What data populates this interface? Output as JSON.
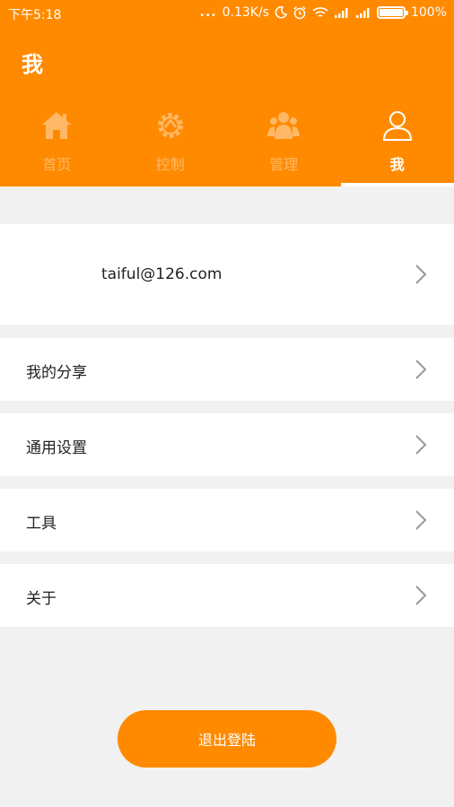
{
  "status_bar": {
    "time": "下午5:18",
    "dots": "...",
    "network_speed": "0.13K/s",
    "battery_text": "100%",
    "icons": [
      "moon-icon",
      "alarm-icon",
      "wifi-icon",
      "signal-icon",
      "signal-icon",
      "battery-icon"
    ]
  },
  "header": {
    "title": "我"
  },
  "tabs": [
    {
      "label": "首页",
      "icon": "home-icon",
      "active": false
    },
    {
      "label": "控制",
      "icon": "gear-icon",
      "active": false
    },
    {
      "label": "管理",
      "icon": "users-icon",
      "active": false
    },
    {
      "label": "我",
      "icon": "user-icon",
      "active": true
    }
  ],
  "account": {
    "email": "taiful@126.com"
  },
  "menu": [
    {
      "label": "我的分享"
    },
    {
      "label": "通用设置"
    },
    {
      "label": "工具"
    },
    {
      "label": "关于"
    }
  ],
  "logout_label": "退出登陆",
  "colors": {
    "accent": "#ff8a00",
    "background": "#f1f1f1",
    "inactive_tab": "#ffb866"
  }
}
